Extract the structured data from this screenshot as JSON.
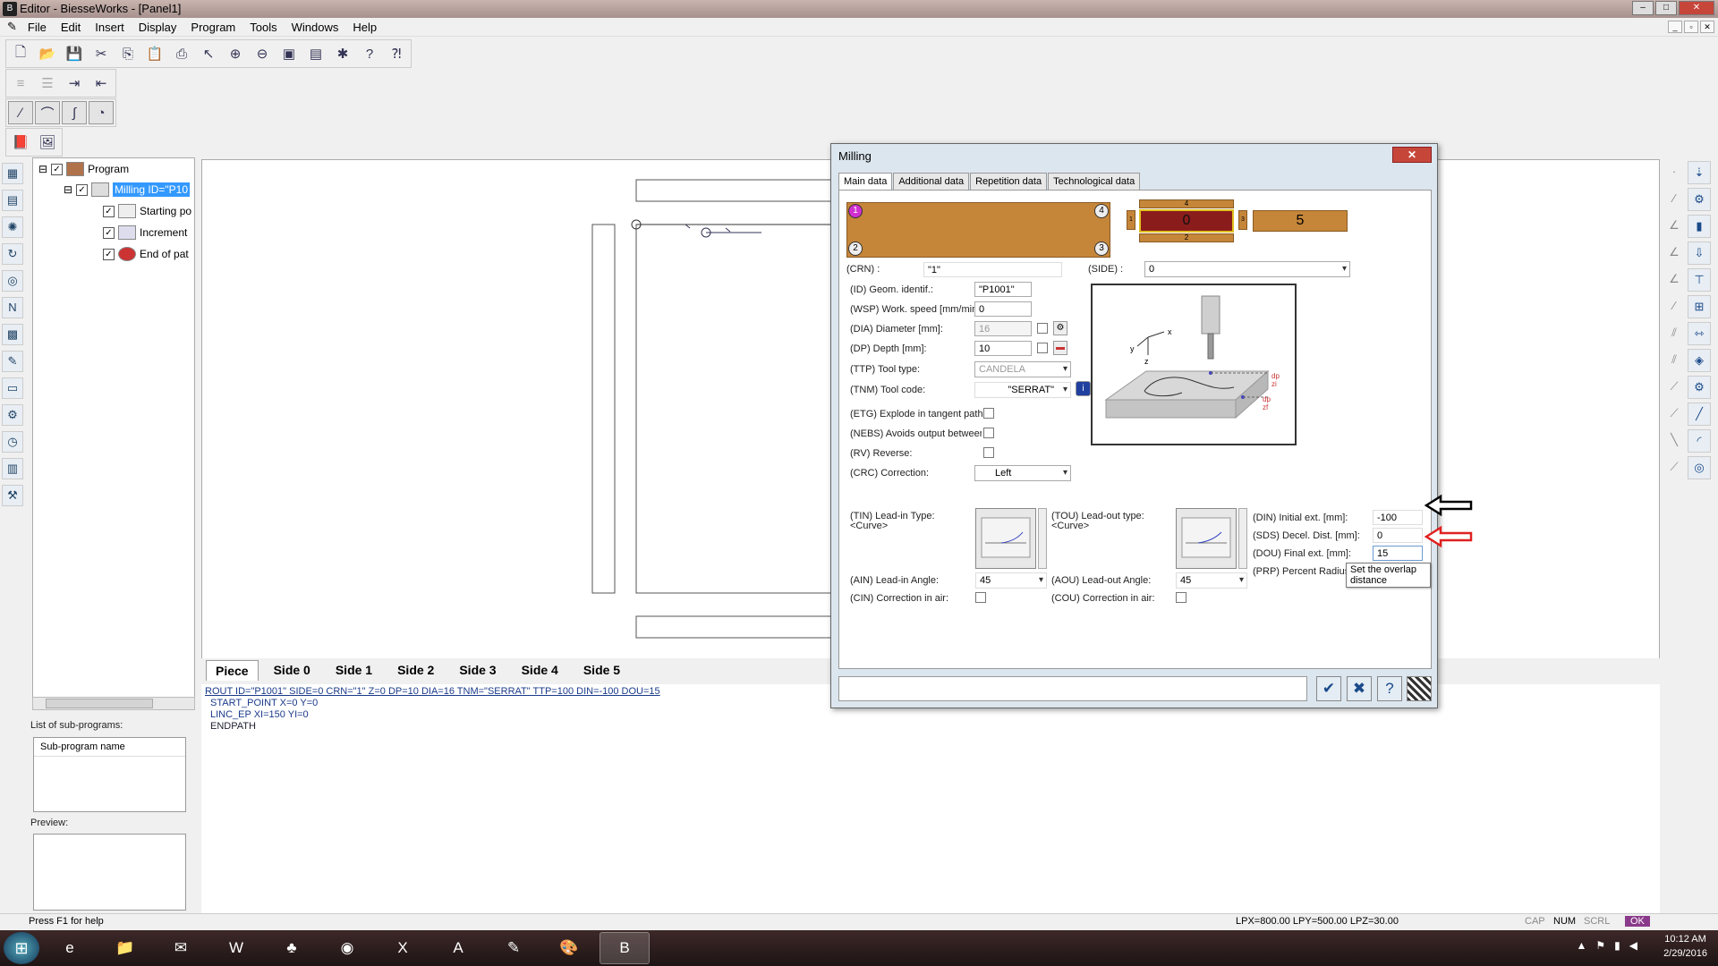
{
  "window": {
    "title": "Editor - BiesseWorks - [Panel1]"
  },
  "menu": [
    "File",
    "Edit",
    "Insert",
    "Display",
    "Program",
    "Tools",
    "Windows",
    "Help"
  ],
  "tree": {
    "root": "Program",
    "milling": "Milling ID=\"P10",
    "children": [
      "Starting po",
      "Increment",
      "End of pat"
    ]
  },
  "subprograms": {
    "list_label": "List of sub-programs:",
    "column": "Sub-program name",
    "preview_label": "Preview:"
  },
  "side_tabs": [
    "Piece",
    "Side 0",
    "Side 1",
    "Side 2",
    "Side 3",
    "Side 4",
    "Side 5"
  ],
  "code": {
    "line1": "ROUT ID=\"P1001\" SIDE=0 CRN=\"1\" Z=0 DP=10 DIA=16 TNM=\"SERRAT\" TTP=100 DIN=-100 DOU=15",
    "line2": "START_POINT X=0 Y=0",
    "line3": "LINC_EP XI=150 YI=0",
    "line4": "ENDPATH"
  },
  "status": {
    "help": "Press F1 for help",
    "dims": "LPX=800.00 LPY=500.00 LPZ=30.00",
    "cap": "CAP",
    "num": "NUM",
    "scrl": "SCRL",
    "ok": "OK"
  },
  "taskbar": {
    "time": "10:12 AM",
    "date": "2/29/2016"
  },
  "dialog": {
    "title": "Milling",
    "tabs": [
      "Main data",
      "Additional data",
      "Repetition data",
      "Technological data"
    ],
    "corners": [
      "1",
      "4",
      "2",
      "3"
    ],
    "crn_label": "(CRN) :",
    "crn_value": "\"1\"",
    "side_label": "(SIDE) :",
    "side_value": "0",
    "face_value": "0",
    "count_value": "5",
    "face_small": [
      "4",
      "1",
      "2",
      "3"
    ],
    "fields": {
      "id": {
        "label": "(ID) Geom. identif.:",
        "value": "\"P1001\""
      },
      "wsp": {
        "label": "(WSP) Work. speed [mm/min]:",
        "value": "0"
      },
      "dia": {
        "label": "(DIA) Diameter [mm]:",
        "value": "16"
      },
      "dp": {
        "label": "(DP) Depth [mm]:",
        "value": "10"
      },
      "ttp": {
        "label": "(TTP) Tool type:",
        "value": "CANDELA"
      },
      "tnm": {
        "label": "(TNM) Tool code:",
        "value": "\"SERRAT\""
      },
      "etg": {
        "label": "(ETG) Explode in tangent paths:"
      },
      "nebs": {
        "label": "(NEBS) Avoids output between the r"
      },
      "rv": {
        "label": "(RV) Reverse:"
      },
      "crc": {
        "label": "(CRC) Correction:",
        "value": "Left"
      },
      "tin": {
        "label": "(TIN) Lead-in Type:",
        "sub": "<Curve>"
      },
      "tou": {
        "label": "(TOU) Lead-out type:",
        "sub": "<Curve>"
      },
      "ain": {
        "label": "(AIN) Lead-in Angle:",
        "value": "45"
      },
      "aou": {
        "label": "(AOU) Lead-out Angle:",
        "value": "45"
      },
      "cin": {
        "label": "(CIN) Correction in air:"
      },
      "cou": {
        "label": "(COU) Correction in air:"
      },
      "din": {
        "label": "(DIN) Initial ext. [mm]:",
        "value": "-100"
      },
      "sds": {
        "label": "(SDS) Decel. Dist. [mm]:",
        "value": "0"
      },
      "dou": {
        "label": "(DOU) Final ext. [mm]:",
        "value": "15"
      },
      "prp": {
        "label": "(PRP) Percent Radius"
      }
    },
    "tooltip": "Set the overlap distance",
    "diagram_labels": {
      "x": "x",
      "y": "y",
      "z": "z",
      "dp1": "dp",
      "zi": "zi",
      "dp2": "dp",
      "zf": "zf"
    }
  }
}
